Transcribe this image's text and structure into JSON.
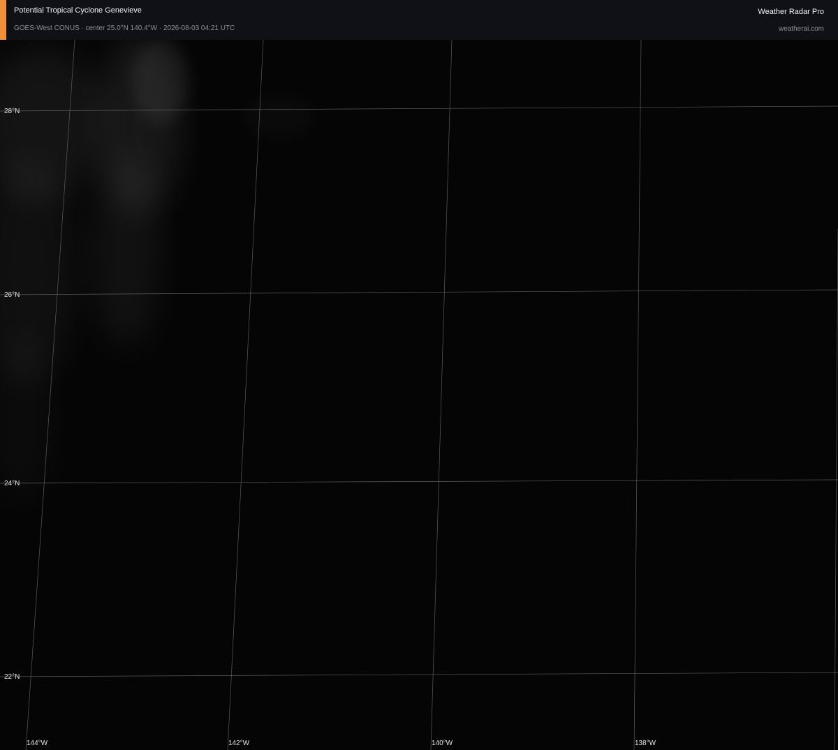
{
  "header": {
    "title": "Potential Tropical Cyclone Genevieve",
    "subtitle": "GOES-West CONUS · center 25.0°N 140.4°W · 2026-08-03 04:21 UTC",
    "brand": "Weather Radar Pro",
    "site": "weatherai.com",
    "accent_color": "#f0913a"
  },
  "map": {
    "latitudes": [
      "28°N",
      "26°N",
      "24°N",
      "22°N"
    ],
    "longitudes": [
      "144°W",
      "142°W",
      "140°W",
      "138°W"
    ],
    "gridline_color": "#6a6a6a",
    "background_color": "#050505",
    "cloud_tint": "#cfcfcf"
  }
}
